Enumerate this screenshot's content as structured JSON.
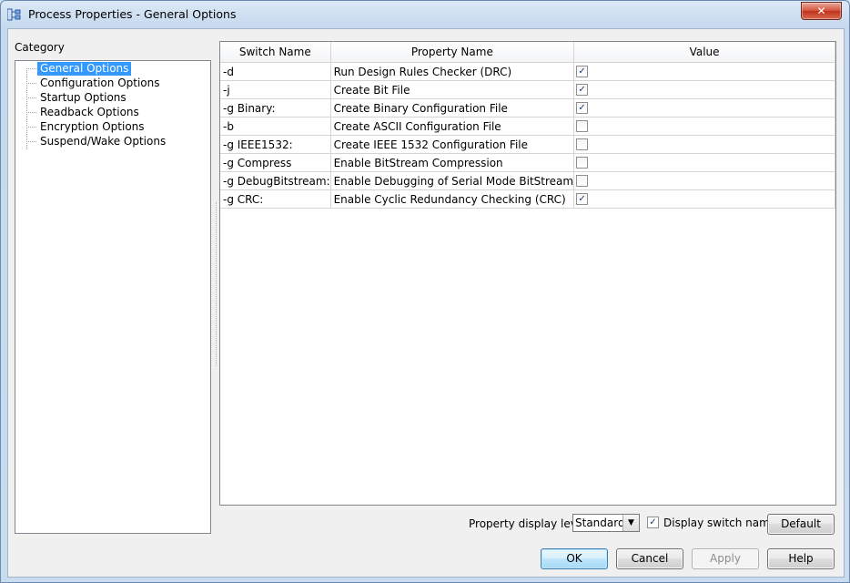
{
  "window": {
    "title": "Process Properties - General Options",
    "close_glyph": "✕"
  },
  "category": {
    "label": "Category",
    "items": [
      {
        "label": "General Options",
        "selected": true
      },
      {
        "label": "Configuration Options",
        "selected": false
      },
      {
        "label": "Startup Options",
        "selected": false
      },
      {
        "label": "Readback Options",
        "selected": false
      },
      {
        "label": "Encryption Options",
        "selected": false
      },
      {
        "label": "Suspend/Wake Options",
        "selected": false
      }
    ]
  },
  "grid": {
    "headers": [
      "Switch Name",
      "Property Name",
      "Value"
    ],
    "rows": [
      {
        "switch": "-d",
        "property": "Run Design Rules Checker (DRC)",
        "checked": true
      },
      {
        "switch": "-j",
        "property": "Create Bit File",
        "checked": true
      },
      {
        "switch": "-g Binary:",
        "property": "Create Binary Configuration File",
        "checked": true
      },
      {
        "switch": "-b",
        "property": "Create ASCII Configuration File",
        "checked": false
      },
      {
        "switch": "-g IEEE1532:",
        "property": "Create IEEE 1532 Configuration File",
        "checked": false
      },
      {
        "switch": "-g Compress",
        "property": "Enable BitStream Compression",
        "checked": false
      },
      {
        "switch": "-g DebugBitstream:",
        "property": "Enable Debugging of Serial Mode BitStream",
        "checked": false
      },
      {
        "switch": "-g CRC:",
        "property": "Enable Cyclic Redundancy Checking (CRC)",
        "checked": true
      }
    ]
  },
  "footer": {
    "display_level_label": "Property display level:",
    "display_level_value": "Standard",
    "display_switch_names_label": "Display switch names",
    "display_switch_names_checked": true,
    "default_button": "Default",
    "ok_button": "OK",
    "cancel_button": "Cancel",
    "apply_button": "Apply",
    "help_button": "Help"
  },
  "colors": {
    "selection": "#3399ff",
    "close_button": "#c1321c",
    "check_mark": "#1f3a78"
  }
}
